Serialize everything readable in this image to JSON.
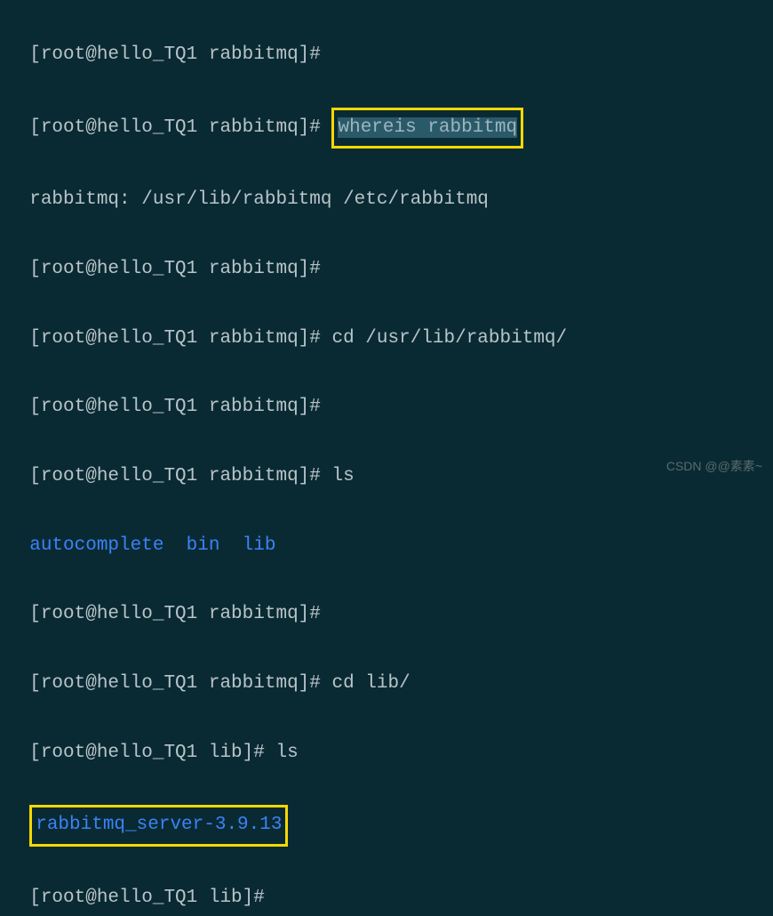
{
  "lines": {
    "l1_prompt": "[root@hello_TQ1 rabbitmq]#",
    "l2_prompt": "[root@hello_TQ1 rabbitmq]# ",
    "l2_cmd": "whereis rabbitmq",
    "l3_output": "rabbitmq: /usr/lib/rabbitmq /etc/rabbitmq",
    "l4_prompt": "[root@hello_TQ1 rabbitmq]#",
    "l5_prompt": "[root@hello_TQ1 rabbitmq]# ",
    "l5_cmd": "cd /usr/lib/rabbitmq/",
    "l6_prompt": "[root@hello_TQ1 rabbitmq]#",
    "l7_prompt": "[root@hello_TQ1 rabbitmq]# ",
    "l7_cmd": "ls",
    "l8_listing": "autocomplete  bin  lib",
    "l9_prompt": "[root@hello_TQ1 rabbitmq]#",
    "l10_prompt": "[root@hello_TQ1 rabbitmq]# ",
    "l10_cmd": "cd lib/",
    "l11_prompt": "[root@hello_TQ1 lib]# ",
    "l11_cmd": "ls",
    "l12_listing": "rabbitmq_server-3.9.13",
    "l13_prompt": "[root@hello_TQ1 lib]#"
  },
  "watermark": "CSDN @@素素~"
}
